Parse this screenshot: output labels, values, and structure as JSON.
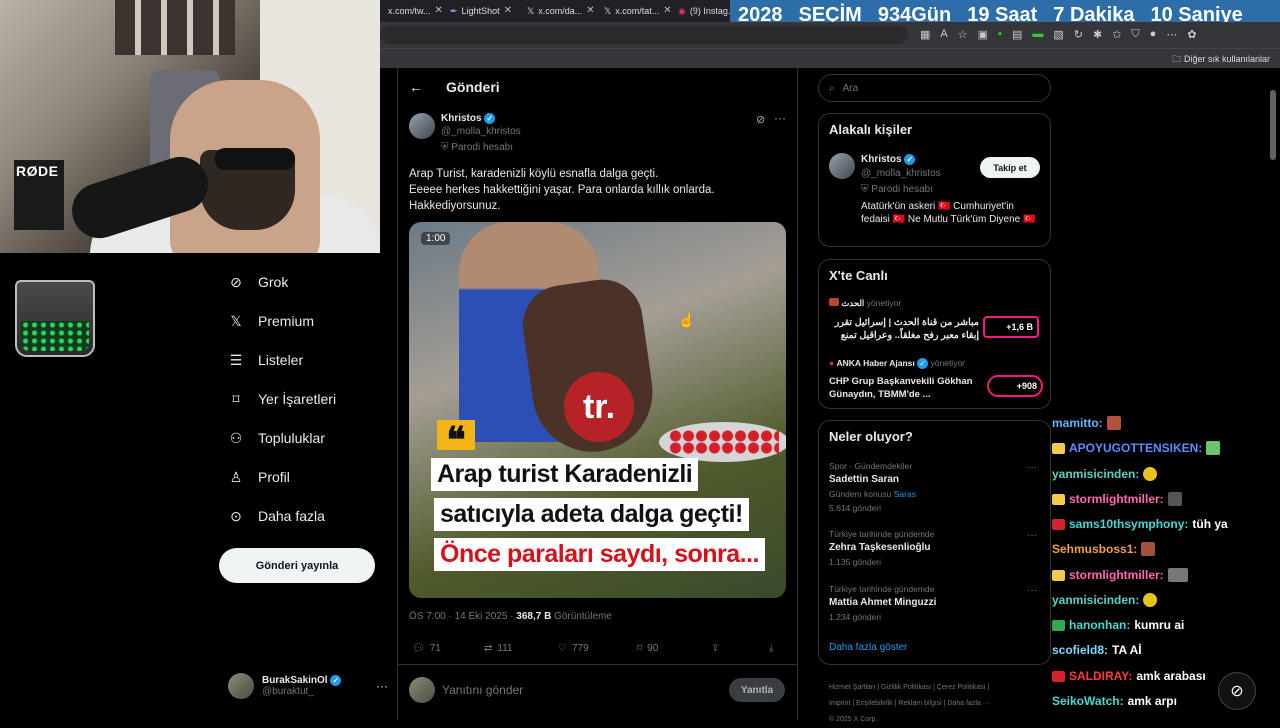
{
  "browser": {
    "tabs": [
      {
        "label": "x.com/tw..."
      },
      {
        "label": "LightShot"
      },
      {
        "label": "x.com/da..."
      },
      {
        "label": "x.com/tat..."
      },
      {
        "label": "(9) Instag..."
      }
    ],
    "bookmarks_other": "Diğer sık kullanılanlar"
  },
  "countdown": {
    "year": "2028",
    "label": "SEÇİM",
    "days": "934",
    "days_unit": "Gün",
    "hours": "19",
    "hours_unit": "Saat",
    "minutes": "7",
    "minutes_unit": "Dakika",
    "seconds": "10",
    "seconds_unit": "Saniye"
  },
  "webcam": {
    "mic_brand": "RØDE"
  },
  "nav": {
    "items": [
      {
        "label": "Grok",
        "icon": "grok-icon"
      },
      {
        "label": "Premium",
        "icon": "x-logo-icon"
      },
      {
        "label": "Listeler",
        "icon": "list-icon"
      },
      {
        "label": "Yer İşaretleri",
        "icon": "bookmark-icon"
      },
      {
        "label": "Topluluklar",
        "icon": "communities-icon"
      },
      {
        "label": "Profil",
        "icon": "profile-icon"
      },
      {
        "label": "Daha fazla",
        "icon": "more-circle-icon"
      }
    ],
    "post_button": "Gönderi yayınla",
    "account": {
      "name": "BurakSakinOl",
      "handle": "@buraktut_",
      "more": "···"
    }
  },
  "post": {
    "header_title": "Gönderi",
    "author_name": "Khristos",
    "author_handle": "@_molla_khristos",
    "parody_label": "Parodi hesabı",
    "text_lines": [
      "Arap Turist, karadenizli köylü esnafla dalga geçti.",
      "Eeeee herkes hakkettiğini yaşar. Para onlarda kıllık onlarda.",
      "Hakkediyorsunuz."
    ],
    "media": {
      "timer": "1:00",
      "logo": "tr.",
      "quote_mark": "❝",
      "caption_lines": [
        "Arap turist Karadenizli",
        "satıcıyla adeta dalga geçti!",
        "Önce paraları saydı, sonra..."
      ]
    },
    "timestamp": "ÖS 7:00 · 14 Eki 2025 · ",
    "views_count": "368,7 B",
    "views_label": " Görüntüleme",
    "stats": {
      "replies": "71",
      "reposts": "111",
      "likes": "779",
      "bookmarks": "90"
    },
    "reply_placeholder": "Yanıtını gönder",
    "reply_button": "Yanıtla"
  },
  "sidebar": {
    "search_placeholder": "Ara",
    "related": {
      "title": "Alakalı kişiler",
      "name": "Khristos",
      "handle": "@_molla_khristos",
      "parody": "Parodi hesabı",
      "follow": "Takip et",
      "bio": "Atatürk'ün askeri 🇹🇷 Cumhuriyet'in fedaisi 🇹🇷 Ne Mutlu Türk'üm Diyene 🇹🇷"
    },
    "live": {
      "title": "X'te Canlı",
      "items": [
        {
          "host": "الحدث",
          "role": "yönetiyor",
          "title": "مباشر من قناة الحدث | إسرائيل تقرر إبقاء معبر رفح مغلقاً.. وعراقيل تمنع",
          "count": "+1,6 B"
        },
        {
          "host": "ANKA Haber Ajansı",
          "role": "yönetiyor",
          "title": "CHP Grup Başkanvekili Gökhan Günaydın, TBMM'de ...",
          "count": "+908"
        }
      ]
    },
    "trends": {
      "title": "Neler oluyor?",
      "items": [
        {
          "context": "Spor · Gündemdekiler",
          "name": "Sadettin Saran",
          "extra_prefix": "Gündem konusu ",
          "extra_link": "Saras",
          "count": "5.614 gönderi"
        },
        {
          "context": "Türkiye tarihinde gündemde",
          "name": "Zehra Taşkesenlioğlu",
          "count": "1.135 gönderi"
        },
        {
          "context": "Türkiye tarihinde gündemde",
          "name": "Mattia Ahmet Minguzzi",
          "count": "1.234 gönderi"
        }
      ],
      "show_more": "Daha fazla göster"
    },
    "footer": {
      "links": [
        "Hizmet Şartları",
        "Gizlilik Politikası",
        "Çerez Politikası",
        "Imprint",
        "Erişilebilirlik",
        "Reklam bilgisi",
        "Daha fazla ···"
      ],
      "copyright": "© 2025 X Corp."
    }
  },
  "chat": [
    {
      "user": "mamitto:",
      "message": "",
      "color": "#5fb4ff"
    },
    {
      "user": "APOYUGOTTENSIKEN:",
      "message": "",
      "color": "#5f8bff"
    },
    {
      "user": "yanmisicinden:",
      "message": "",
      "color": "#5bd0c4"
    },
    {
      "user": "stormlightmiller:",
      "message": "",
      "color": "#ff69b4"
    },
    {
      "user": "sams10thsymphony:",
      "message": "tüh ya",
      "color": "#46d9d0"
    },
    {
      "user": "Sehmusboss1:",
      "message": "",
      "color": "#f0a040"
    },
    {
      "user": "stormlightmiller:",
      "message": "",
      "color": "#ff69b4"
    },
    {
      "user": "yanmisicinden:",
      "message": "",
      "color": "#5bd0c4"
    },
    {
      "user": "hanonhan:",
      "message": "kumru ai",
      "color": "#46d9d0"
    },
    {
      "user": "scofield8:",
      "message": "TA Aİ",
      "color": "#7fd8ff"
    },
    {
      "user": "SALDIRAY:",
      "message": "amk arabası",
      "color": "#ff3b3b"
    },
    {
      "user": "SeikoWatch:",
      "message": "amk arpı",
      "color": "#46d9d0"
    }
  ]
}
